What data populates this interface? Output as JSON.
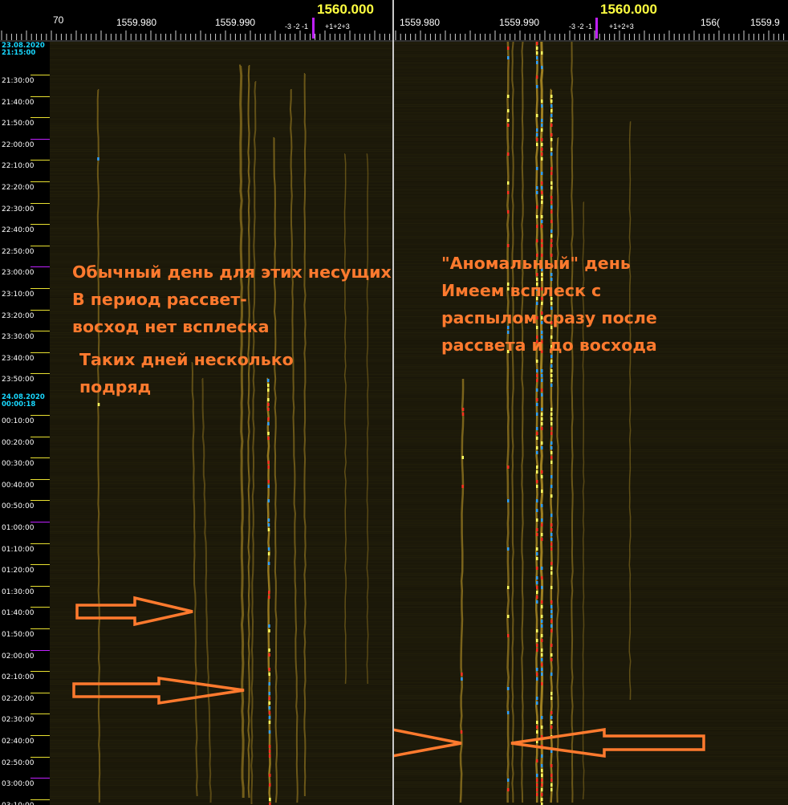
{
  "left_panel": {
    "center_freq": "1560.000",
    "freq_labels": [
      "70",
      "1559.980",
      "1559.990"
    ],
    "offset_labels": [
      "-3 -2 -1",
      "+1+2+3"
    ],
    "date_start": "23.08.2020",
    "time_start": "21:15:00",
    "date_mid": "24.08.2020",
    "time_mid": "00:00:18",
    "time_labels": [
      "21:30:00",
      "21:40:00",
      "21:50:00",
      "22:00:00",
      "22:10:00",
      "22:20:00",
      "22:30:00",
      "22:40:00",
      "22:50:00",
      "23:00:00",
      "23:10:00",
      "23:20:00",
      "23:30:00",
      "23:40:00",
      "23:50:00",
      "00:10:00",
      "00:20:00",
      "00:30:00",
      "00:40:00",
      "00:50:00",
      "01:00:00",
      "01:10:00",
      "01:20:00",
      "01:30:00",
      "01:40:00",
      "01:50:00",
      "02:00:00",
      "02:10:00",
      "02:20:00",
      "02:30:00",
      "02:40:00",
      "02:50:00",
      "03:00:00",
      "03:10:00"
    ],
    "annotation_1": [
      "Обычный день для этих несущих",
      "В период рассвет-",
      "восход нет всплеска"
    ],
    "annotation_2": [
      "Таких дней несколько",
      "подряд"
    ]
  },
  "right_panel": {
    "center_freq": "1560.000",
    "freq_labels": [
      "1559.980",
      "1559.990",
      "156(",
      "1559.9"
    ],
    "offset_labels": [
      "-3 -2 -1",
      "+1+2+3"
    ],
    "annotation": [
      "\"Аномальный\" день",
      "Имеем всплеск с",
      "распылом сразу после",
      "рассвета и до восхода"
    ]
  },
  "colors": {
    "annotation": "#ff7a2e",
    "center_freq": "#ffff40",
    "date_text": "#18d8ff",
    "waterfall_trace": "#c9a12a",
    "marker_magenta": "#c020ff"
  }
}
